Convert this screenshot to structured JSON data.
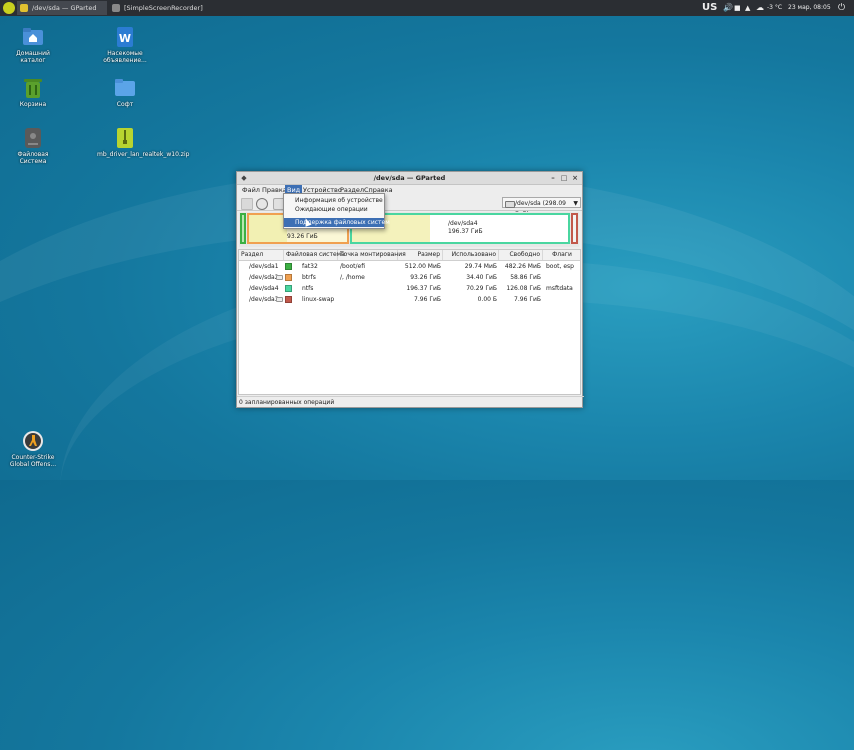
{
  "taskbar": {
    "tasks": [
      {
        "label": "/dev/sda — GParted"
      },
      {
        "label": "[SimpleScreenRecorder]"
      }
    ],
    "tray": {
      "layout": "US",
      "weather": "-3 °C",
      "clock": "23 мар, 08:05"
    }
  },
  "desktop": {
    "icons": [
      {
        "label": "Домашний каталог",
        "icon": "home-folder-icon"
      },
      {
        "label": "Насекомые объявление...",
        "icon": "word-document-icon"
      },
      {
        "label": "Корзина",
        "icon": "trash-icon"
      },
      {
        "label": "Софт",
        "icon": "folder-icon"
      },
      {
        "label": "Файловая Система",
        "icon": "drive-icon"
      },
      {
        "label": "mb_driver_lan_realtek_w10.zip",
        "icon": "archive-icon"
      },
      {
        "label": "Counter-Strike Global Offens...",
        "icon": "game-icon"
      }
    ]
  },
  "window": {
    "title": "/dev/sda — GParted",
    "menu": [
      "Файл",
      "Правка",
      "Вид",
      "Устройство",
      "Раздел",
      "Справка"
    ],
    "device_selector": "/dev/sda   (298.09 ГиБ)",
    "dropdown": [
      "Информация об устройстве",
      "Ожидающие операции",
      "Поддержка файловых систем"
    ],
    "map": {
      "left_size": "93.26 ГиБ",
      "sda4_name": "/dev/sda4",
      "sda4_size": "196.37 ГиБ"
    },
    "columns": [
      "Раздел",
      "Файловая система",
      "Точка монтирования",
      "Размер",
      "Использовано",
      "Свободно",
      "Флаги"
    ],
    "rows": [
      {
        "part": "/dev/sda1",
        "fs": "fat32",
        "color": "#3cb043",
        "mount": "/boot/efi",
        "size": "512.00 МиБ",
        "used": "29.74 МиБ",
        "free": "482.26 МиБ",
        "flags": "boot, esp"
      },
      {
        "part": "/dev/sda2",
        "fs": "btrfs",
        "color": "#f0a050",
        "mount": "/, /home",
        "size": "93.26 ГиБ",
        "used": "34.40 ГиБ",
        "free": "58.86 ГиБ",
        "flags": ""
      },
      {
        "part": "/dev/sda4",
        "fs": "ntfs",
        "color": "#4ad6a0",
        "mount": "",
        "size": "196.37 ГиБ",
        "used": "70.29 ГиБ",
        "free": "126.08 ГиБ",
        "flags": "msftdata"
      },
      {
        "part": "/dev/sda3",
        "fs": "linux-swap",
        "color": "#c2584b",
        "mount": "",
        "size": "7.96 ГиБ",
        "used": "0.00 Б",
        "free": "7.96 ГиБ",
        "flags": ""
      }
    ],
    "status": "0 запланированных операций"
  }
}
